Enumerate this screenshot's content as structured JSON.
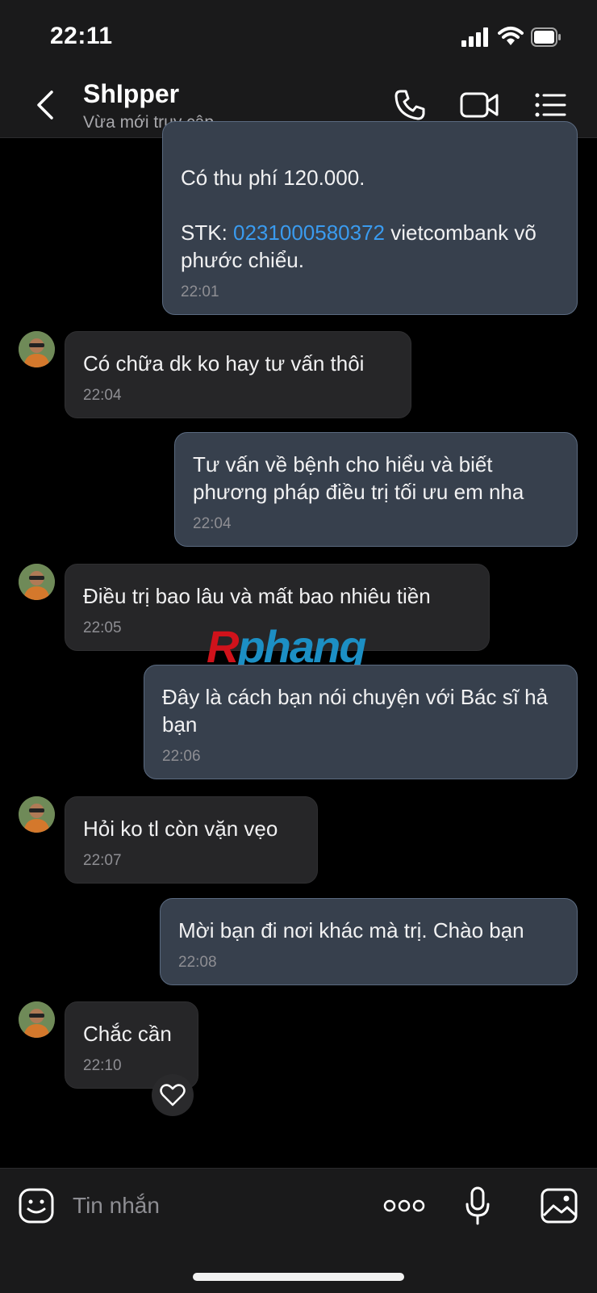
{
  "status_bar": {
    "time": "22:11"
  },
  "header": {
    "title": "ShIpper",
    "subtitle": "Vừa mới truy cập"
  },
  "messages": [
    {
      "direction": "out",
      "lines": [
        "Có thu phí 120.000."
      ],
      "stk_label": "STK: ",
      "account_number": "0231000580372",
      "after_account": " vietcombank võ phước chiểu.",
      "time": "22:01"
    },
    {
      "direction": "in",
      "text": "Có chữa dk ko hay tư vấn thôi",
      "time": "22:04"
    },
    {
      "direction": "out",
      "text": "Tư vấn về bệnh cho hiểu và biết phương pháp điều trị tối ưu em nha",
      "time": "22:04"
    },
    {
      "direction": "in",
      "text": "Điều trị bao lâu và mất bao nhiêu tiền",
      "time": "22:05"
    },
    {
      "direction": "out",
      "text": "Đây là cách bạn nói chuyện với Bác sĩ hả bạn",
      "time": "22:06"
    },
    {
      "direction": "in",
      "text": "Hỏi ko tl còn vặn vẹo",
      "time": "22:07"
    },
    {
      "direction": "out",
      "text": "Mời bạn đi nơi khác mà trị. Chào bạn",
      "time": "22:08"
    },
    {
      "direction": "in",
      "text": "Chắc cần",
      "time": "22:10"
    }
  ],
  "watermark": {
    "first": "R",
    "rest": "phang"
  },
  "input": {
    "placeholder": "Tin nhắn"
  },
  "colors": {
    "outgoing_bubble": "#37404d",
    "incoming_bubble": "#262628",
    "link": "#3a9bef",
    "background": "#000000"
  },
  "icons": [
    "chevron-left-icon",
    "phone-icon",
    "video-camera-icon",
    "list-menu-icon",
    "emoji-sticker-icon",
    "more-dots-icon",
    "microphone-icon",
    "image-icon",
    "heart-icon"
  ]
}
